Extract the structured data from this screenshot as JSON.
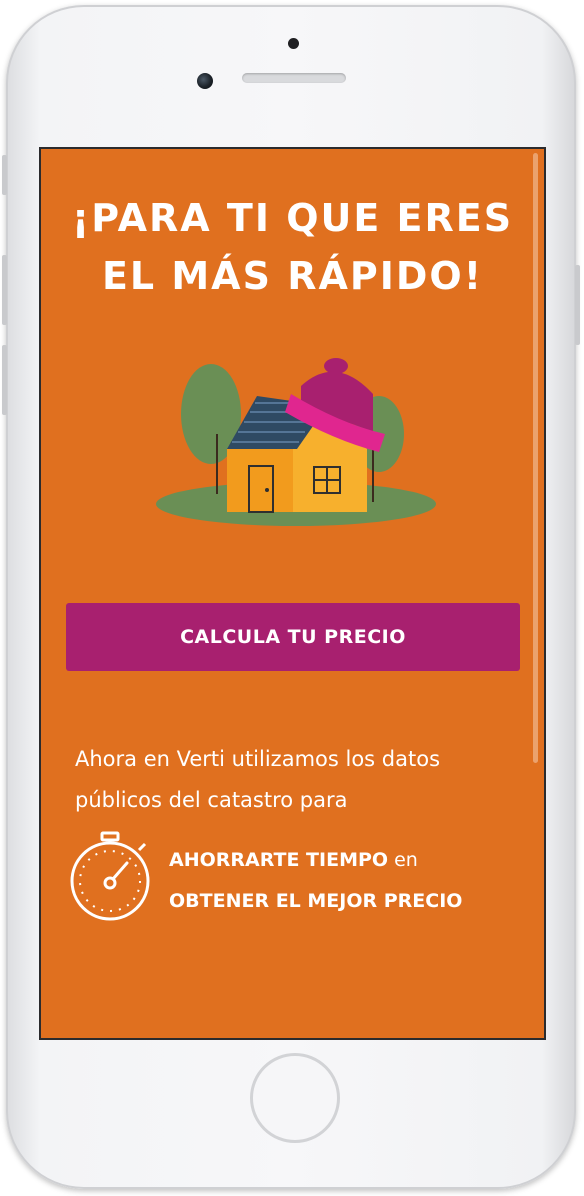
{
  "headline": {
    "line1": "¡PARA TI QUE ERES",
    "line2": "EL MÁS RÁPIDO!"
  },
  "cta": {
    "label": "CALCULA TU PRECIO"
  },
  "intro": {
    "text": "Ahora en Verti utilizamos los datos públicos del catastro para"
  },
  "benefits": {
    "line1_bold": "AHORRARTE TIEMPO",
    "line1_suffix": " en",
    "line2_bold": "OBTENER EL MEJOR PRECIO"
  },
  "colors": {
    "background": "#e0701f",
    "button": "#a8206f",
    "text": "#ffffff"
  },
  "icons": {
    "illustration": "house-with-hat-illustration",
    "benefit": "stopwatch-icon"
  }
}
